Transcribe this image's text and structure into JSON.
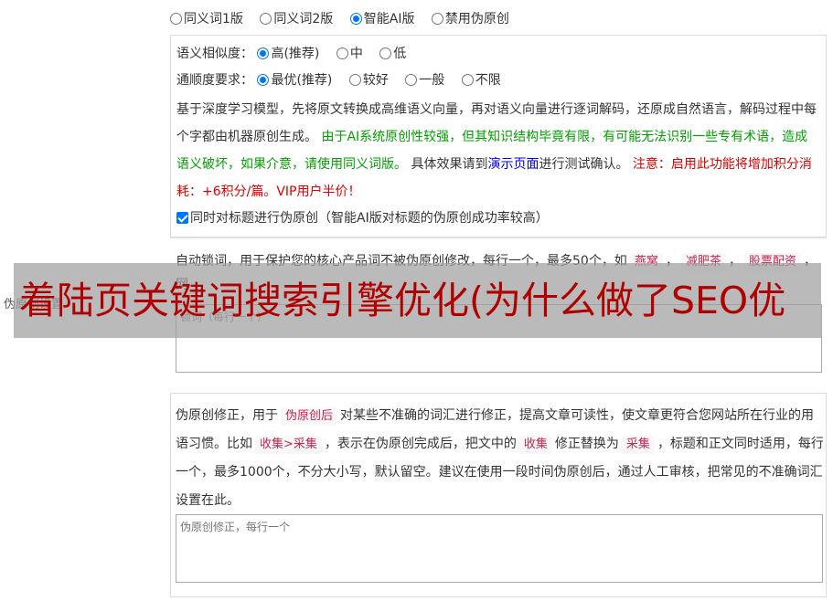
{
  "mode_options": [
    {
      "label": "同义词1版",
      "selected": false
    },
    {
      "label": "同义词2版",
      "selected": false
    },
    {
      "label": "智能AI版",
      "selected": true
    },
    {
      "label": "禁用伪原创",
      "selected": false
    }
  ],
  "similarity": {
    "label": "语义相似度：",
    "options": [
      {
        "label": "高(推荐)",
        "selected": true
      },
      {
        "label": "中",
        "selected": false
      },
      {
        "label": "低",
        "selected": false
      }
    ]
  },
  "fluency": {
    "label": "通顺度要求：",
    "options": [
      {
        "label": "最优(推荐)",
        "selected": true
      },
      {
        "label": "较好",
        "selected": false
      },
      {
        "label": "一般",
        "selected": false
      },
      {
        "label": "不限",
        "selected": false
      }
    ]
  },
  "description": {
    "part1": "基于深度学习模型，先将原文转换成高维语义向量，再对语义向量进行逐词解码，还原成自然语言，解码过程中每个字都由机器原创生成。",
    "part2_green": "由于AI系统原创性较强，但其知识结构毕竟有限，有可能无法识别一些专有术语，造成语义破坏，如果介意，请使用同义词版。",
    "part3": "具体效果请到",
    "demo_link": "演示页面",
    "part4": "进行测试确认。",
    "part5_red": "注意：启用此功能将增加积分消耗：+6积分/篇。VIP用户半价！"
  },
  "title_checkbox": {
    "label": "同时对标题进行伪原创（智能AI版对标题的伪原创成功率较高）",
    "checked": true
  },
  "lock_section": {
    "text1": "自动锁词，用于保护您的核心产品词不被伪原创修改，每行一个，最多50个，如",
    "tags": [
      "燕窝",
      "减肥茶",
      "股票配资"
    ],
    "text2": "网",
    "textarea_placeholder": "锁词（每行一个）",
    "side_label": "伪原创设置"
  },
  "fix_section": {
    "text1": "伪原创修正，用于",
    "tag1": "伪原创后",
    "text2": "对某些不准确的词汇进行修正，提高文章可读性，使文章更符合您网站所在行业的用语习惯。比如",
    "tag2": "收集>采集",
    "text3": "，表示在伪原创完成后，把文中的",
    "tag3": "收集",
    "text4": "修正替换为",
    "tag4": "采集",
    "text5": "，标题和正文同时适用，每行一个，最多1000个，不分大小写，默认留空。建议在使用一段时间伪原创后，通过人工审核，把常见的不准确词汇设置在此。",
    "textarea_placeholder": "伪原创修正，每行一个"
  },
  "banner_text": "着陆页关键词搜索引擎优化(为什么做了SEO优"
}
